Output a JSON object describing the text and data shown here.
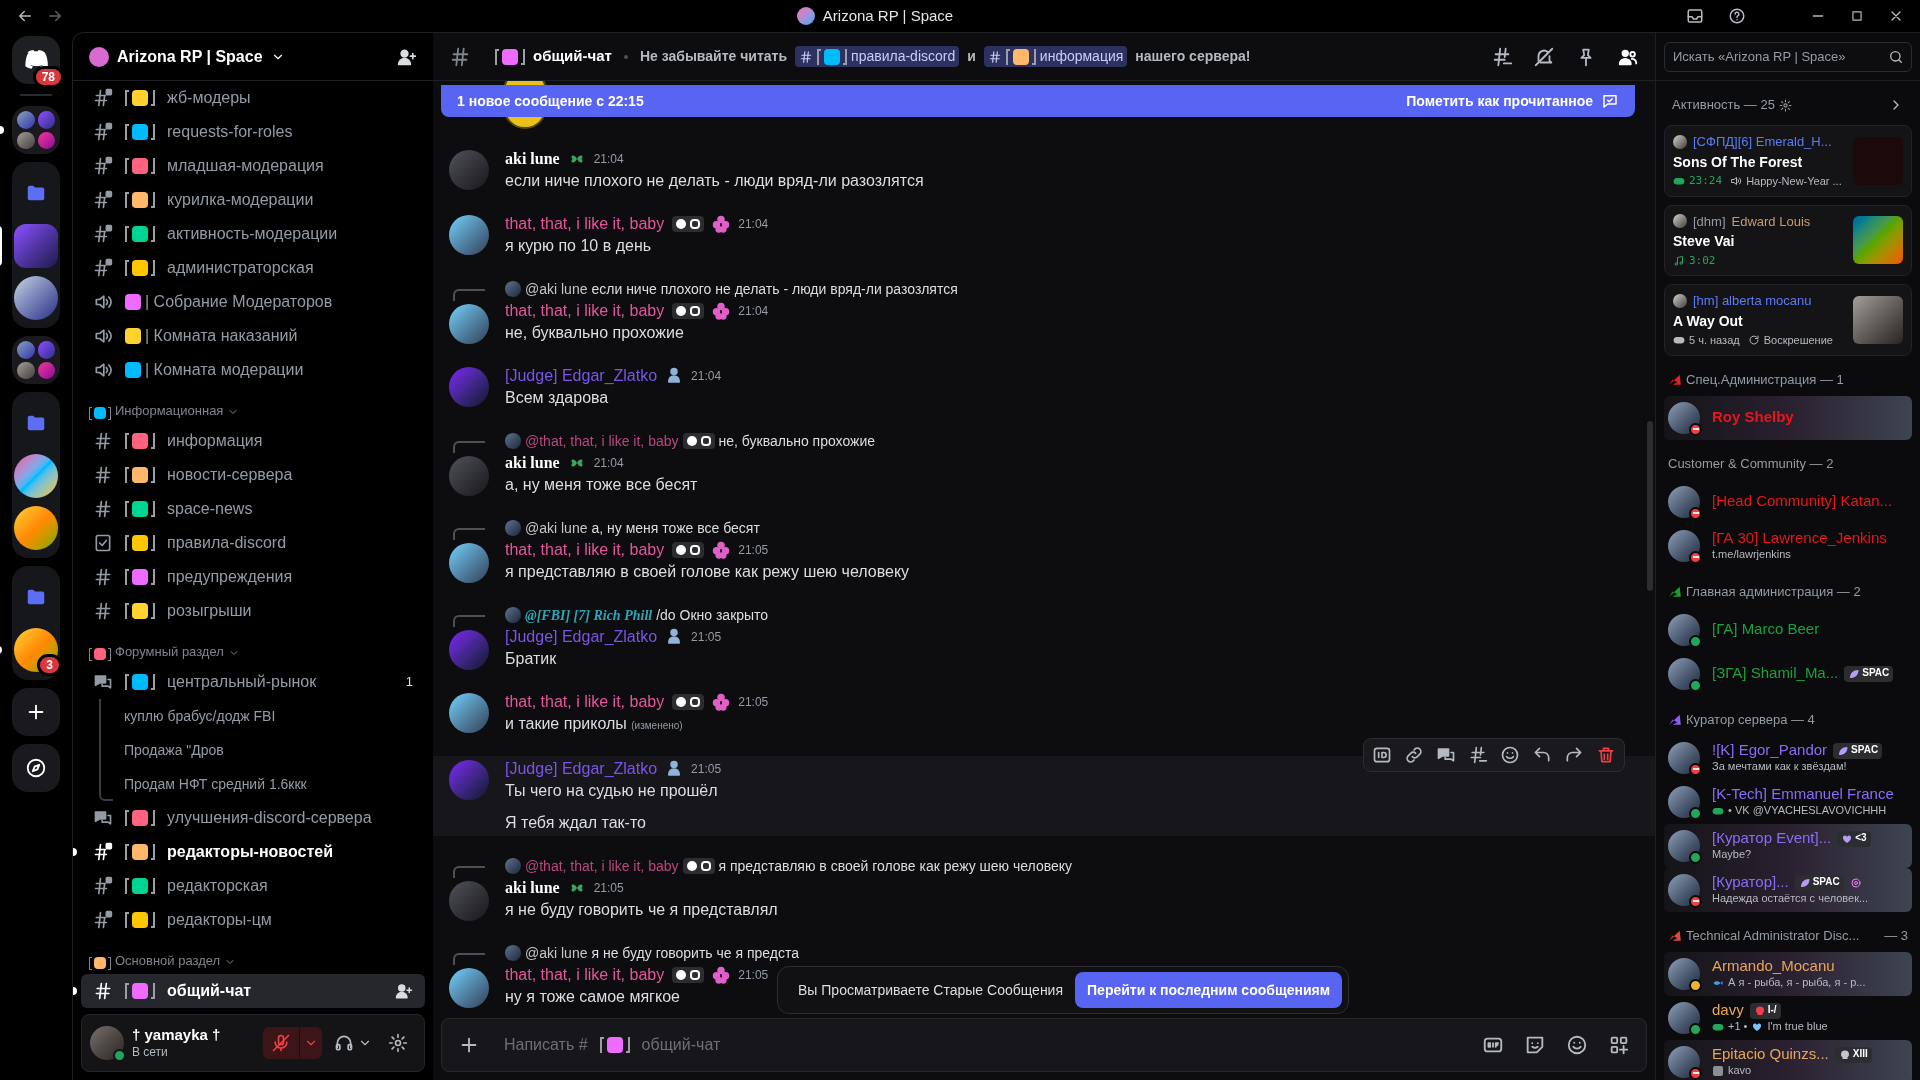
{
  "window": {
    "title": "Arizona RP | Space"
  },
  "servers": [
    {
      "kind": "home",
      "badge": "78"
    },
    {
      "kind": "folder",
      "open": false,
      "unread": true
    },
    {
      "kind": "folder",
      "open": true,
      "children": [
        {
          "selected": true
        },
        {
          "selected": false
        }
      ]
    },
    {
      "kind": "folder",
      "open": false
    },
    {
      "kind": "folder",
      "open": true,
      "children": [
        {
          "selected": false
        },
        {
          "selected": false
        }
      ]
    },
    {
      "kind": "folder",
      "open": true,
      "children": [
        {
          "selected": false,
          "unread": true,
          "badge": "3"
        }
      ]
    },
    {
      "kind": "add"
    },
    {
      "kind": "explore"
    }
  ],
  "sidebar": {
    "server_name": "Arizona RP | Space",
    "groups": [
      {
        "channels": [
          {
            "kind": "locked",
            "name": "жб-модеры",
            "selected": false,
            "unread": false
          },
          {
            "kind": "locked",
            "name": "requests-for-roles",
            "selected": false,
            "unread": false
          },
          {
            "kind": "locked",
            "name": "младшая-модерация",
            "selected": false,
            "unread": false
          },
          {
            "kind": "locked",
            "name": "курилка-модерации",
            "selected": false,
            "unread": false
          },
          {
            "kind": "locked",
            "name": "активность-модерации",
            "selected": false,
            "unread": false
          },
          {
            "kind": "locked",
            "name": "администраторская",
            "selected": false,
            "unread": false
          },
          {
            "kind": "voice",
            "name": "| Собрание Модераторов",
            "selected": false,
            "unread": false
          },
          {
            "kind": "voice",
            "name": "| Комната наказаний",
            "selected": false,
            "unread": false
          },
          {
            "kind": "voice",
            "name": "| Комната модерации",
            "selected": false,
            "unread": false
          }
        ]
      },
      {
        "category": "Информационная",
        "channels": [
          {
            "kind": "text",
            "name": "информация",
            "selected": false,
            "unread": false
          },
          {
            "kind": "text",
            "name": "новости-сервера",
            "selected": false,
            "unread": false
          },
          {
            "kind": "text",
            "name": "space-news",
            "selected": false,
            "unread": false
          },
          {
            "kind": "rules",
            "name": "правила-discord",
            "selected": false,
            "unread": false
          },
          {
            "kind": "text",
            "name": "предупреждения",
            "selected": false,
            "unread": false
          },
          {
            "kind": "text",
            "name": "розыгрыши",
            "selected": false,
            "unread": false
          }
        ]
      },
      {
        "category": "Форумный раздел",
        "channels": [
          {
            "kind": "forum",
            "name": "центральный-рынок",
            "selected": false,
            "unread": false,
            "count": "1",
            "children": [
              {
                "name": "куплю брабус/додж FBI"
              },
              {
                "name": "Продажа \"Дров"
              },
              {
                "name": "Продам НФТ средний 1.6ккк"
              }
            ]
          },
          {
            "kind": "forum",
            "name": "улучшения-discord-сервера",
            "selected": false,
            "unread": false
          },
          {
            "kind": "locked",
            "name": "редакторы-новостей",
            "selected": false,
            "unread": true
          },
          {
            "kind": "locked",
            "name": "редакторская",
            "selected": false,
            "unread": false
          },
          {
            "kind": "locked",
            "name": "редакторы-цм",
            "selected": false,
            "unread": false
          }
        ]
      },
      {
        "category": "Основной раздел",
        "channels": [
          {
            "kind": "text",
            "name": "общий-чат",
            "selected": true,
            "unread": true
          }
        ]
      }
    ]
  },
  "user": {
    "name": "† yamayka †",
    "status": "В сети",
    "muted": true
  },
  "chat": {
    "channel": "общий-чат",
    "topic": [
      {
        "kind": "text",
        "text": "Не забывайте читать"
      },
      {
        "kind": "mention",
        "text": "правила-discord"
      },
      {
        "kind": "text",
        "text": "и"
      },
      {
        "kind": "mention",
        "text": "информация"
      },
      {
        "kind": "text",
        "text": "нашего сервера!"
      }
    ],
    "new_bar": {
      "text": "1 новое сообщение с 22:15",
      "action": "Пометить как прочитанное"
    },
    "messages": [
      {
        "author": "aki lune",
        "color": "#ffffff",
        "kind": "clover",
        "time": "21:04",
        "lines": [
          "если ниче плохого не делать - люди вряд-ли разозлятся"
        ],
        "hovered": false
      },
      {
        "author": "that, that, i like it, baby",
        "color": "#e4559c",
        "kind": "chip",
        "time": "21:04",
        "lines": [
          "я курю по 10 в день"
        ],
        "hovered": false
      },
      {
        "reply": {
          "author": "@aki lune",
          "color": "#c4c6cc",
          "kind": "plain",
          "text": "если ниче плохого не делать - люди вряд-ли разозлятся"
        },
        "author": "that, that, i like it, baby",
        "color": "#e4559c",
        "kind": "chip",
        "time": "21:04",
        "lines": [
          "не, буквально прохожие"
        ],
        "hovered": false
      },
      {
        "author": "[Judge] Edgar_Zlatko",
        "color": "#7b54e8",
        "kind": "judge",
        "time": "21:04",
        "lines": [
          "Всем здарова"
        ],
        "hovered": false
      },
      {
        "reply": {
          "author": "@that, that, i like it, baby",
          "color": "#b8467f",
          "kind": "chip",
          "text": "не, буквально прохожие"
        },
        "author": "aki lune",
        "color": "#ffffff",
        "kind": "clover",
        "time": "21:04",
        "lines": [
          "а, ну меня тоже все бесят"
        ],
        "hovered": false
      },
      {
        "reply": {
          "author": "@aki lune",
          "color": "#c4c6cc",
          "kind": "plain",
          "text": "а, ну меня тоже все бесят"
        },
        "author": "that, that, i like it, baby",
        "color": "#e4559c",
        "kind": "chip",
        "time": "21:05",
        "lines": [
          "я представляю в своей голове как режу шею человеку"
        ],
        "hovered": false
      },
      {
        "reply": {
          "author": "@[FBI] [7] Rich Phill",
          "color": "#2aa7b8",
          "kind": "fancy",
          "text": "/do Окно закрыто"
        },
        "author": "[Judge] Edgar_Zlatko",
        "color": "#7b54e8",
        "kind": "judge",
        "time": "21:05",
        "lines": [
          "Братик"
        ],
        "hovered": false
      },
      {
        "author": "that, that, i like it, baby",
        "color": "#e4559c",
        "kind": "chip",
        "time": "21:05",
        "lines": [
          "и такие приколы"
        ],
        "edited": "(изменено)",
        "hovered": false
      },
      {
        "author": "[Judge] Edgar_Zlatko",
        "color": "#7b54e8",
        "kind": "judge",
        "time": "21:05",
        "lines": [
          "Ты чего на судью не прошёл",
          "Я тебя ждал так-то"
        ],
        "hovered": true
      },
      {
        "reply": {
          "author": "@that, that, i like it, baby",
          "color": "#b8467f",
          "kind": "chip",
          "text": "я представляю в своей голове как режу шею человеку"
        },
        "author": "aki lune",
        "color": "#ffffff",
        "kind": "clover",
        "time": "21:05",
        "lines": [
          "я не буду говорить че я представлял"
        ],
        "hovered": false
      },
      {
        "reply": {
          "author": "@aki lune",
          "color": "#c4c6cc",
          "kind": "plain",
          "text": "я не буду говорить че я предста"
        },
        "author": "that, that, i like it, baby",
        "color": "#e4559c",
        "kind": "chip",
        "time": "21:05",
        "lines": [
          "ну я тоже самое мягкое"
        ],
        "hovered": false
      }
    ],
    "jump_bar": {
      "text": "Вы Просматриваете Старые Сообщения",
      "button": "Перейти к последним сообщениям"
    },
    "composer": {
      "placeholder": "Написать #",
      "channel": "общий-чат"
    }
  },
  "members": {
    "search": {
      "placeholder": "Искать «Arizona RP | Space»"
    },
    "activity": {
      "title": "Активность — 25",
      "cards": [
        {
          "name": "[СФПД][6] Emerald_H...",
          "color": "#5b7cf7",
          "title": "Sons Of The Forest",
          "meta": [
            {
              "kind": "game",
              "text": "23:24",
              "live": true
            },
            {
              "kind": "speaker",
              "text": "Happy-New-Year ...",
              "live": false
            }
          ]
        },
        {
          "tag": "[dhm]",
          "name": "Edward Louis",
          "color": "#c99a6c",
          "title": "Steve Vai",
          "meta": [
            {
              "kind": "music",
              "text": "3:02",
              "live": true
            }
          ]
        },
        {
          "name": "[hm] alberta mocanu",
          "color": "#5b7cf7",
          "title": "A Way Out",
          "meta": [
            {
              "kind": "game",
              "text": "5 ч. назад",
              "live": false
            },
            {
              "kind": "refresh",
              "text": "Воскрешение",
              "live": false
            }
          ]
        }
      ]
    },
    "groups": [
      {
        "title": "Спец.Администрация — 1",
        "color": "#e31e24",
        "members": [
          {
            "name": "Roy Shelby",
            "color": "#e8161b",
            "status": {
              "kind": "dnd"
            },
            "banner": true,
            "boost": false
          }
        ]
      },
      {
        "title": "Customer & Community — 2",
        "members": [
          {
            "name": "[Head Community] Katan...",
            "color": "#e8161b",
            "status": {
              "kind": "dnd"
            },
            "banner": false,
            "boost": false
          },
          {
            "name": "[ГА 30] Lawrence_Jenkins",
            "color": "#e8161b",
            "status": {
              "kind": "dnd"
            },
            "banner": false,
            "boost": false,
            "sub": {
              "kind": "plain",
              "text": "t.me/lawrjenkins"
            }
          }
        ]
      },
      {
        "title": "Главная администрация — 2",
        "color": "#1e9c2e",
        "members": [
          {
            "name": "[ГА] Marco Beer",
            "color": "#16a33c",
            "status": {
              "kind": "online"
            },
            "banner": false,
            "boost": false
          },
          {
            "name": "[ЗГА] Shamil_Ma...",
            "color": "#16a33c",
            "status": {
              "kind": "online"
            },
            "banner": false,
            "boost": false,
            "tag": {
              "kind": "leaf",
              "text": "SPAC"
            }
          }
        ]
      },
      {
        "title": "Куратор сервера — 4",
        "color": "#8e5cf0",
        "members": [
          {
            "name": "![K] Egor_Pandor",
            "color": "#8b6cf7",
            "status": {
              "kind": "dnd"
            },
            "banner": false,
            "boost": false,
            "tag": {
              "kind": "leaf",
              "text": "SPAC"
            },
            "sub": {
              "kind": "plain",
              "text": "За мечтами как к звёздам!"
            }
          },
          {
            "name": "[K-Tech] Emmanuel France",
            "color": "#8b6cf7",
            "status": {
              "kind": "online"
            },
            "banner": false,
            "boost": false,
            "sub": {
              "kind": "game",
              "text": "• VK @VYACHESLAVOVICHHH"
            }
          },
          {
            "name": "[Куратор Event]...",
            "color": "#8b6cf7",
            "status": {
              "kind": "online"
            },
            "banner": true,
            "boost": false,
            "tag": {
              "kind": "heart",
              "text": "<3"
            },
            "sub": {
              "kind": "plain",
              "text": "Maybe?"
            }
          },
          {
            "name": "[Куратор]...",
            "color": "#8b6cf7",
            "status": {
              "kind": "dnd"
            },
            "banner": true,
            "boost": true,
            "tag": {
              "kind": "leaf",
              "text": "SPAC"
            },
            "sub": {
              "kind": "plain",
              "text": "Надежда остаётся с человек..."
            }
          }
        ]
      },
      {
        "title": "Technical Administrator Disc...",
        "count": "— 3",
        "color": "#e0463c",
        "members": [
          {
            "name": "Armando_Mocanu",
            "color": "#e8a65a",
            "status": {
              "kind": "idle"
            },
            "banner": true,
            "boost": false,
            "sub": {
              "kind": "fish",
              "text": "А я - рыба, я - рыба, я - р..."
            }
          },
          {
            "name": "davy",
            "color": "#e8a65a",
            "status": {
              "kind": "online"
            },
            "banner": false,
            "boost": false,
            "tag": {
              "kind": "skull",
              "text": "I-/"
            },
            "sub": {
              "kind": "game",
              "text": "+1 •"
            },
            "sub2": {
              "kind": "heart",
              "text": "I'm true blue"
            }
          },
          {
            "name": "Epitacio Quinzs...",
            "color": "#e8a65a",
            "status": {
              "kind": "dnd"
            },
            "banner": true,
            "boost": false,
            "tag": {
              "kind": "skull-gray",
              "text": "XIII"
            },
            "sub": {
              "kind": "image",
              "text": "kavo"
            }
          }
        ]
      }
    ]
  }
}
